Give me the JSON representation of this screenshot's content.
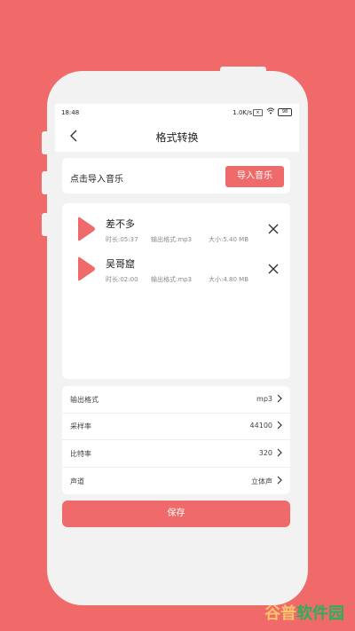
{
  "status_bar": {
    "time": "18:48",
    "speed": "1.0K/s",
    "sim": "×",
    "battery": "98"
  },
  "navbar": {
    "title": "格式转换",
    "back_icon": "chevron-left-icon"
  },
  "import": {
    "label": "点击导入音乐",
    "button": "导入音乐"
  },
  "files": [
    {
      "name": "差不多",
      "duration": "时长:05:37",
      "format": "输出格式:mp3",
      "size": "大小:5.40 MB"
    },
    {
      "name": "吴哥窟",
      "duration": "时长:02:00",
      "format": "输出格式:mp3",
      "size": "大小:4.80 MB"
    }
  ],
  "settings": [
    {
      "label": "输出格式",
      "value": "mp3"
    },
    {
      "label": "采样率",
      "value": "44100"
    },
    {
      "label": "比特率",
      "value": "320"
    },
    {
      "label": "声道",
      "value": "立体声"
    }
  ],
  "save_label": "保存",
  "watermark": {
    "part1": "谷普",
    "part2": "软件园"
  },
  "colors": {
    "background": "#f06a6a",
    "accent": "#ef6a6a",
    "card": "#ffffff"
  }
}
